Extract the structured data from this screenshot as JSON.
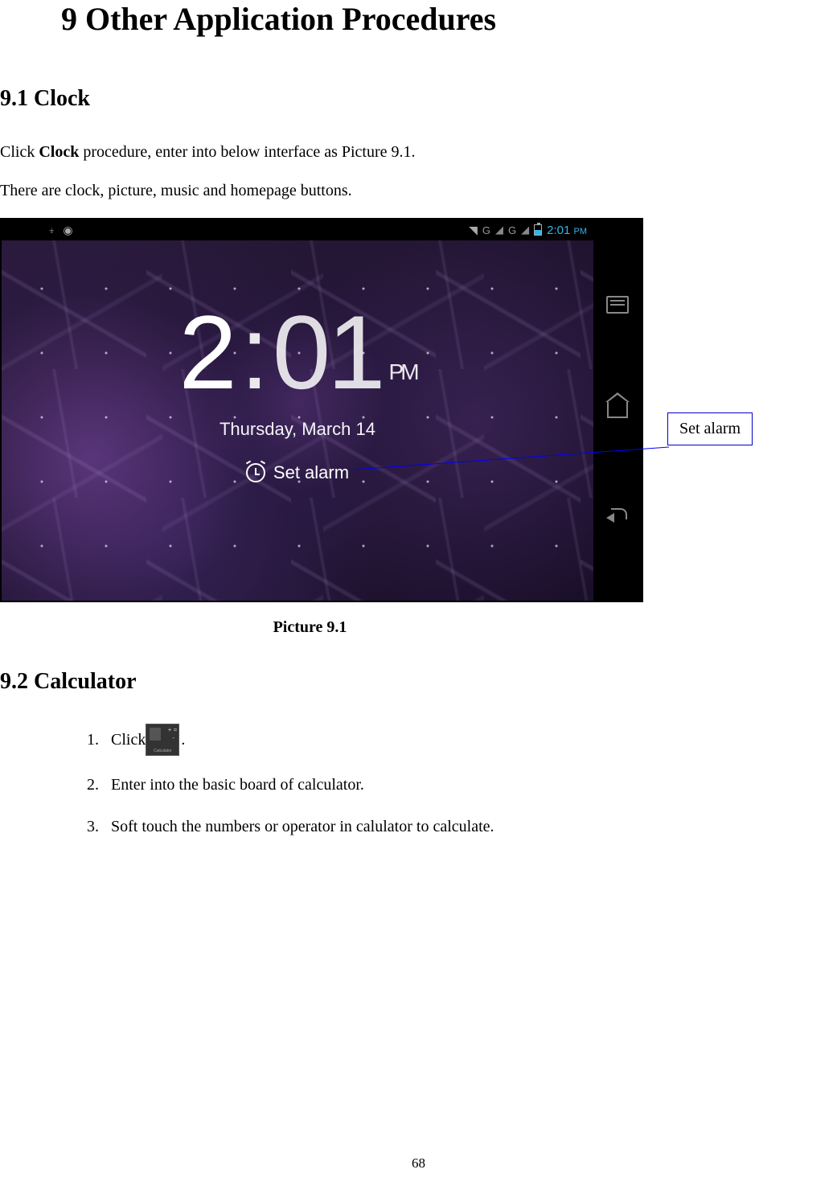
{
  "page": {
    "title": "9 Other Application Procedures",
    "number": "68"
  },
  "section_clock": {
    "heading": "9.1 Clock",
    "intro_prefix": "Click ",
    "intro_bold": "Clock",
    "intro_suffix": " procedure, enter into below interface as Picture 9.1.",
    "intro_line2": "There are clock, picture, music and homepage buttons.",
    "caption": "Picture 9.1"
  },
  "screenshot": {
    "statusbar": {
      "time": "2:01",
      "ampm": "PM",
      "g_label": "G",
      "wifi_icon": "wifi",
      "usb_icon": "usb",
      "android_icon": "android"
    },
    "clock": {
      "hours": "2",
      "colon": ":",
      "minutes": "01",
      "ampm": "PM",
      "date": "Thursday, March 14",
      "set_alarm_label": "Set alarm"
    },
    "nav": {
      "recent": "recent",
      "home": "home",
      "back": "back"
    }
  },
  "callout": {
    "label": "Set alarm"
  },
  "section_calc": {
    "heading": "9.2 Calculator",
    "items": {
      "1": {
        "num": "1.",
        "prefix": "Click",
        "icon_label": "Calculator",
        "suffix": "."
      },
      "2": {
        "num": "2.",
        "text": "Enter into the basic board of calculator."
      },
      "3": {
        "num": "3.",
        "text": "Soft touch the numbers or operator in calulator to calculate."
      }
    }
  }
}
